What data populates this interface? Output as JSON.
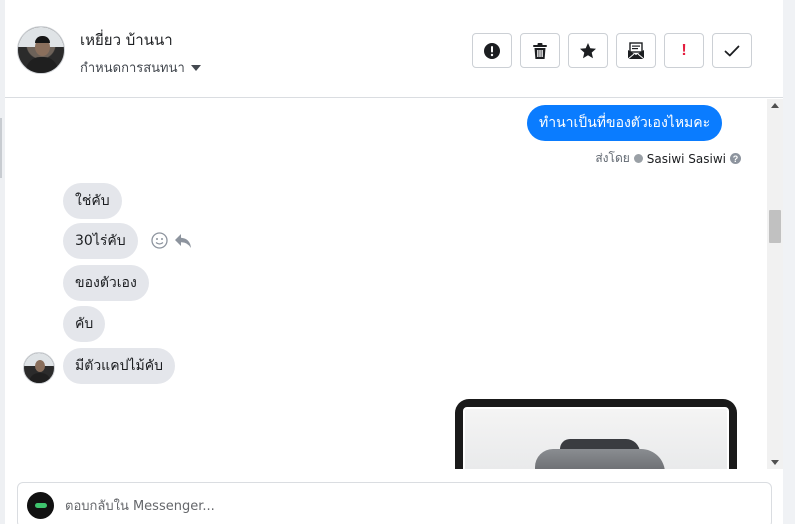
{
  "header": {
    "user_name": "เหยี่ยว บ้านนา",
    "assign_label": "กำหนดการสนทนา"
  },
  "toolbar": {
    "buttons": [
      {
        "icon": "alert-circle-icon",
        "name": "spam-button"
      },
      {
        "icon": "trash-icon",
        "name": "delete-button"
      },
      {
        "icon": "star-icon",
        "name": "star-button"
      },
      {
        "icon": "mail-envelope-icon",
        "name": "mark-unread-button"
      },
      {
        "icon": "exclamation-icon",
        "name": "follow-up-button",
        "glyph": "!"
      },
      {
        "icon": "check-icon",
        "name": "mark-done-button"
      }
    ]
  },
  "conversation": {
    "outgoing": {
      "text": "ทำนาเป็นที่ของตัวเองไหมคะ",
      "sent_by_label": "ส่งโดย",
      "agent_name": "Sasiwi Sasiwi"
    },
    "incoming": [
      {
        "text": "ใช่คับ"
      },
      {
        "text": "30ไร่คับ"
      },
      {
        "text": "ของตัวเอง"
      },
      {
        "text": "คับ"
      },
      {
        "text": "มีตัวแคปไม้คับ"
      }
    ]
  },
  "composer": {
    "placeholder": "ตอบกลับใน Messenger..."
  },
  "colors": {
    "outgoing_bubble": "#0a7cff",
    "incoming_bubble": "#e4e6eb",
    "follow_up_red": "#e41e3f"
  }
}
